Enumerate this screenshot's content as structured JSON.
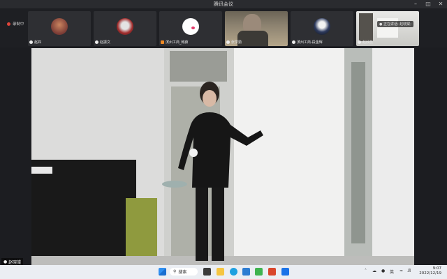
{
  "window": {
    "title": "腾讯会议"
  },
  "recording": {
    "label": "录制中"
  },
  "participants": [
    {
      "name": "赵四"
    },
    {
      "name": "赵振文"
    },
    {
      "name": "滨州工商_韩茹"
    },
    {
      "name": "张学勤"
    },
    {
      "name": "滨州工商-段金辉"
    },
    {
      "name": "赵欣蕊"
    }
  ],
  "speaking_banner": {
    "text": "正在讲话: 赵晓棠;"
  },
  "main_speaker": {
    "name": "赵晓棠"
  },
  "taskbar": {
    "search_label": "搜索",
    "lang_indicator": "英",
    "time": "9:07",
    "date": "2022/12/19"
  },
  "colors": {
    "accent": "#0f6cbd",
    "recording": "#e0453b"
  }
}
